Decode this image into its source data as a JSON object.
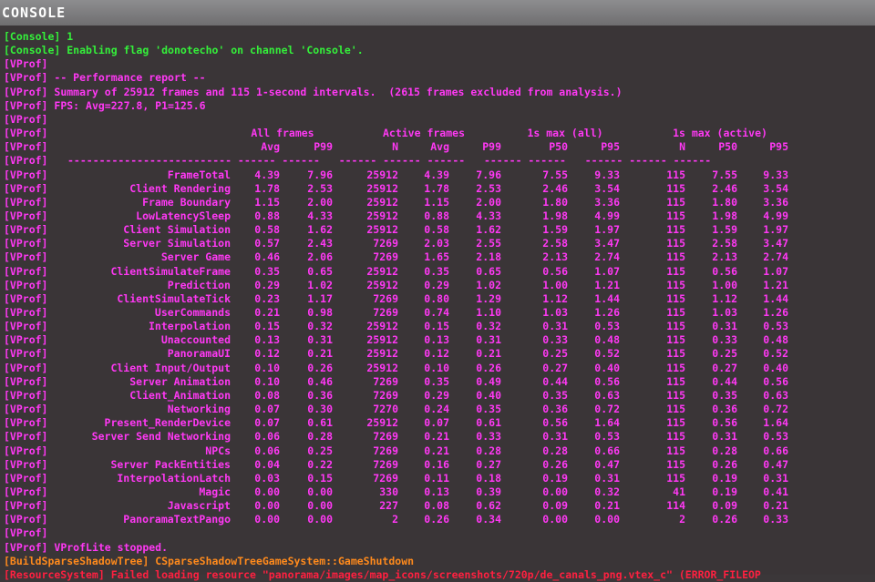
{
  "window": {
    "title": "CONSOLE"
  },
  "colors": {
    "console_channel": "#34f03a",
    "vprof": "#ff38f4",
    "warning": "#ff8a1c",
    "error": "#ff2040",
    "background": "#3a3537"
  },
  "intro_lines": [
    {
      "tag": "[Console]",
      "text": "1",
      "color": "g"
    },
    {
      "tag": "[Console]",
      "text": "Enabling flag 'donotecho' on channel 'Console'.",
      "color": "g"
    },
    {
      "tag": "[VProf]",
      "text": "",
      "color": "m"
    },
    {
      "tag": "[VProf]",
      "text": "-- Performance report --",
      "color": "m"
    },
    {
      "tag": "[VProf]",
      "text": "Summary of 25912 frames and 115 1-second intervals.  (2615 frames excluded from analysis.)",
      "color": "m"
    },
    {
      "tag": "[VProf]",
      "text": "FPS: Avg=227.8, P1=125.6",
      "color": "m"
    },
    {
      "tag": "[VProf]",
      "text": "",
      "color": "m"
    }
  ],
  "table": {
    "tag": "[VProf]",
    "groups": [
      "All frames",
      "Active frames",
      "1s max (all)",
      "1s max (active)"
    ],
    "columns": [
      "Avg",
      "P99",
      "N",
      "Avg",
      "P99",
      "P50",
      "P95",
      "N",
      "P50",
      "P95"
    ],
    "rows": [
      [
        "FrameTotal",
        "4.39",
        "7.96",
        "25912",
        "4.39",
        "7.96",
        "7.55",
        "9.33",
        "115",
        "7.55",
        "9.33"
      ],
      [
        "Client Rendering",
        "1.78",
        "2.53",
        "25912",
        "1.78",
        "2.53",
        "2.46",
        "3.54",
        "115",
        "2.46",
        "3.54"
      ],
      [
        "Frame Boundary",
        "1.15",
        "2.00",
        "25912",
        "1.15",
        "2.00",
        "1.80",
        "3.36",
        "115",
        "1.80",
        "3.36"
      ],
      [
        "LowLatencySleep",
        "0.88",
        "4.33",
        "25912",
        "0.88",
        "4.33",
        "1.98",
        "4.99",
        "115",
        "1.98",
        "4.99"
      ],
      [
        "Client Simulation",
        "0.58",
        "1.62",
        "25912",
        "0.58",
        "1.62",
        "1.59",
        "1.97",
        "115",
        "1.59",
        "1.97"
      ],
      [
        "Server Simulation",
        "0.57",
        "2.43",
        "7269",
        "2.03",
        "2.55",
        "2.58",
        "3.47",
        "115",
        "2.58",
        "3.47"
      ],
      [
        "Server Game",
        "0.46",
        "2.06",
        "7269",
        "1.65",
        "2.18",
        "2.13",
        "2.74",
        "115",
        "2.13",
        "2.74"
      ],
      [
        "ClientSimulateFrame",
        "0.35",
        "0.65",
        "25912",
        "0.35",
        "0.65",
        "0.56",
        "1.07",
        "115",
        "0.56",
        "1.07"
      ],
      [
        "Prediction",
        "0.29",
        "1.02",
        "25912",
        "0.29",
        "1.02",
        "1.00",
        "1.21",
        "115",
        "1.00",
        "1.21"
      ],
      [
        "ClientSimulateTick",
        "0.23",
        "1.17",
        "7269",
        "0.80",
        "1.29",
        "1.12",
        "1.44",
        "115",
        "1.12",
        "1.44"
      ],
      [
        "UserCommands",
        "0.21",
        "0.98",
        "7269",
        "0.74",
        "1.10",
        "1.03",
        "1.26",
        "115",
        "1.03",
        "1.26"
      ],
      [
        "Interpolation",
        "0.15",
        "0.32",
        "25912",
        "0.15",
        "0.32",
        "0.31",
        "0.53",
        "115",
        "0.31",
        "0.53"
      ],
      [
        "Unaccounted",
        "0.13",
        "0.31",
        "25912",
        "0.13",
        "0.31",
        "0.33",
        "0.48",
        "115",
        "0.33",
        "0.48"
      ],
      [
        "PanoramaUI",
        "0.12",
        "0.21",
        "25912",
        "0.12",
        "0.21",
        "0.25",
        "0.52",
        "115",
        "0.25",
        "0.52"
      ],
      [
        "Client Input/Output",
        "0.10",
        "0.26",
        "25912",
        "0.10",
        "0.26",
        "0.27",
        "0.40",
        "115",
        "0.27",
        "0.40"
      ],
      [
        "Server Animation",
        "0.10",
        "0.46",
        "7269",
        "0.35",
        "0.49",
        "0.44",
        "0.56",
        "115",
        "0.44",
        "0.56"
      ],
      [
        "Client_Animation",
        "0.08",
        "0.36",
        "7269",
        "0.29",
        "0.40",
        "0.35",
        "0.63",
        "115",
        "0.35",
        "0.63"
      ],
      [
        "Networking",
        "0.07",
        "0.30",
        "7270",
        "0.24",
        "0.35",
        "0.36",
        "0.72",
        "115",
        "0.36",
        "0.72"
      ],
      [
        "Present_RenderDevice",
        "0.07",
        "0.61",
        "25912",
        "0.07",
        "0.61",
        "0.56",
        "1.64",
        "115",
        "0.56",
        "1.64"
      ],
      [
        "Server Send Networking",
        "0.06",
        "0.28",
        "7269",
        "0.21",
        "0.33",
        "0.31",
        "0.53",
        "115",
        "0.31",
        "0.53"
      ],
      [
        "NPCs",
        "0.06",
        "0.25",
        "7269",
        "0.21",
        "0.28",
        "0.28",
        "0.66",
        "115",
        "0.28",
        "0.66"
      ],
      [
        "Server PackEntities",
        "0.04",
        "0.22",
        "7269",
        "0.16",
        "0.27",
        "0.26",
        "0.47",
        "115",
        "0.26",
        "0.47"
      ],
      [
        "InterpolationLatch",
        "0.03",
        "0.15",
        "7269",
        "0.11",
        "0.18",
        "0.19",
        "0.31",
        "115",
        "0.19",
        "0.31"
      ],
      [
        "Magic",
        "0.00",
        "0.00",
        "330",
        "0.13",
        "0.39",
        "0.00",
        "0.32",
        "41",
        "0.19",
        "0.41"
      ],
      [
        "Javascript",
        "0.00",
        "0.00",
        "227",
        "0.08",
        "0.62",
        "0.09",
        "0.21",
        "114",
        "0.09",
        "0.21"
      ],
      [
        "PanoramaTextPango",
        "0.00",
        "0.00",
        "2",
        "0.26",
        "0.34",
        "0.00",
        "0.00",
        "2",
        "0.26",
        "0.33"
      ]
    ]
  },
  "outro_lines": [
    {
      "tag": "[VProf]",
      "text": "",
      "color": "m"
    },
    {
      "tag": "[VProf]",
      "text": "VProfLite stopped.",
      "color": "m"
    },
    {
      "tag": "[BuildSparseShadowTree]",
      "text": "CSparseShadowTreeGameSystem::GameShutdown",
      "color": "o"
    },
    {
      "tag": "[ResourceSystem]",
      "text": "Failed loading resource \"panorama/images/map_icons/screenshots/720p/de_canals_png.vtex_c\" (ERROR_FILEOP",
      "color": "r"
    }
  ]
}
